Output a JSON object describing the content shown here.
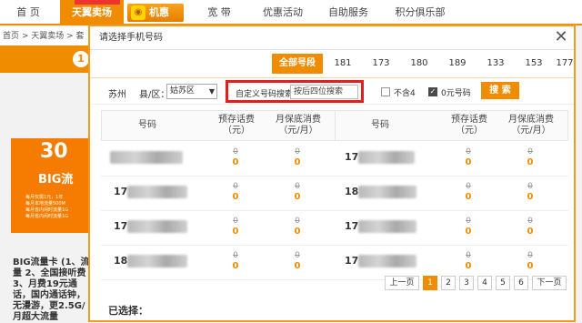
{
  "nav": {
    "items": [
      "首 页",
      "天翼卖场",
      "宽 带",
      "优惠活动",
      "自助服务",
      "积分俱乐部"
    ],
    "logo_text": "机惠",
    "logo_icon": "wifi-icon"
  },
  "background": {
    "breadcrumb": "首页 > 天翼卖场 > 套餐",
    "step_number": "1",
    "ad_big": "30",
    "ad_mid": "BIG流",
    "ad_small": "每月仅需1元，1年\n每月本地流量500M\n每月省内闲时流量1G\n每月省内闲时流量1G",
    "promo_text": "BIG流量卡 (1、流量 2、全国接听费 3、月费19元通话，国内通话钟，无漫游，更2.5G/月超大流量"
  },
  "modal": {
    "title": "请选择手机号码",
    "close_label": "✕",
    "tabs": [
      "全部号段",
      "181",
      "173",
      "180",
      "189",
      "133",
      "153",
      "177"
    ],
    "filter": {
      "city": "苏州",
      "district_label": "县/区：",
      "district_value": "姑苏区",
      "custom_label": "自定义号码搜索：",
      "custom_placeholder": "按后四位搜索",
      "opt_no4_label": "不含4",
      "opt_no4_checked": false,
      "opt_zero_label": "0元号码",
      "opt_zero_checked": true,
      "search_button": "搜 索"
    },
    "table_headers": [
      "号码",
      "预存话费\n（元）",
      "月保底消费\n（元/月）",
      "号码",
      "预存话费\n（元）",
      "月保底消费\n（元/月）"
    ],
    "rows": [
      {
        "left_prefix": "",
        "left_pre_strike": "0",
        "left_pre": "0",
        "left_min_strike": "0",
        "left_min": "0",
        "right_prefix": "17",
        "right_pre_strike": "0",
        "right_pre": "0",
        "right_min_strike": "0",
        "right_min": "0"
      },
      {
        "left_prefix": "17",
        "left_pre_strike": "0",
        "left_pre": "0",
        "left_min_strike": "0",
        "left_min": "0",
        "right_prefix": "18",
        "right_pre_strike": "0",
        "right_pre": "0",
        "right_min_strike": "0",
        "right_min": "0"
      },
      {
        "left_prefix": "17",
        "left_pre_strike": "0",
        "left_pre": "0",
        "left_min_strike": "0",
        "left_min": "0",
        "right_prefix": "17",
        "right_pre_strike": "0",
        "right_pre": "0",
        "right_min_strike": "0",
        "right_min": "0"
      },
      {
        "left_prefix": "18",
        "left_pre_strike": "0",
        "left_pre": "0",
        "left_min_strike": "0",
        "left_min": "0",
        "right_prefix": "17",
        "right_pre_strike": "0",
        "right_pre": "0",
        "right_min_strike": "0",
        "right_min": "0"
      }
    ],
    "pager": {
      "prev": "上一页",
      "pages": [
        "1",
        "2",
        "3",
        "4",
        "5",
        "6"
      ],
      "current": "1",
      "next": "下一页"
    },
    "selected_label": "已选择："
  },
  "colors": {
    "accent": "#f08c00",
    "highlight_border": "#e31e1e"
  }
}
